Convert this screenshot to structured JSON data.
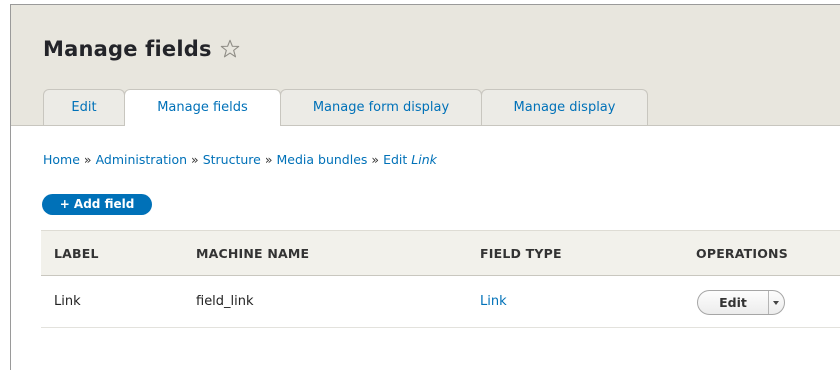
{
  "page": {
    "title": "Manage fields",
    "favorite_icon": "star-outline-icon"
  },
  "tabs": [
    {
      "label": "Edit",
      "active": false
    },
    {
      "label": "Manage fields",
      "active": true
    },
    {
      "label": "Manage form display",
      "active": false
    },
    {
      "label": "Manage display",
      "active": false
    }
  ],
  "breadcrumb": {
    "items": [
      "Home",
      "Administration",
      "Structure",
      "Media bundles"
    ],
    "separator": "»",
    "last_prefix": "Edit",
    "last_emphasis": "Link"
  },
  "actions": {
    "add_field": "+ Add field"
  },
  "table": {
    "headers": {
      "label": "LABEL",
      "machine_name": "MACHINE NAME",
      "field_type": "FIELD TYPE",
      "operations": "OPERATIONS"
    },
    "rows": [
      {
        "label": "Link",
        "machine_name": "field_link",
        "field_type": "Link",
        "operation": "Edit"
      }
    ]
  },
  "colors": {
    "link": "#0071b8",
    "header_bg": "#e8e6de",
    "primary_button": "#0071b8"
  }
}
